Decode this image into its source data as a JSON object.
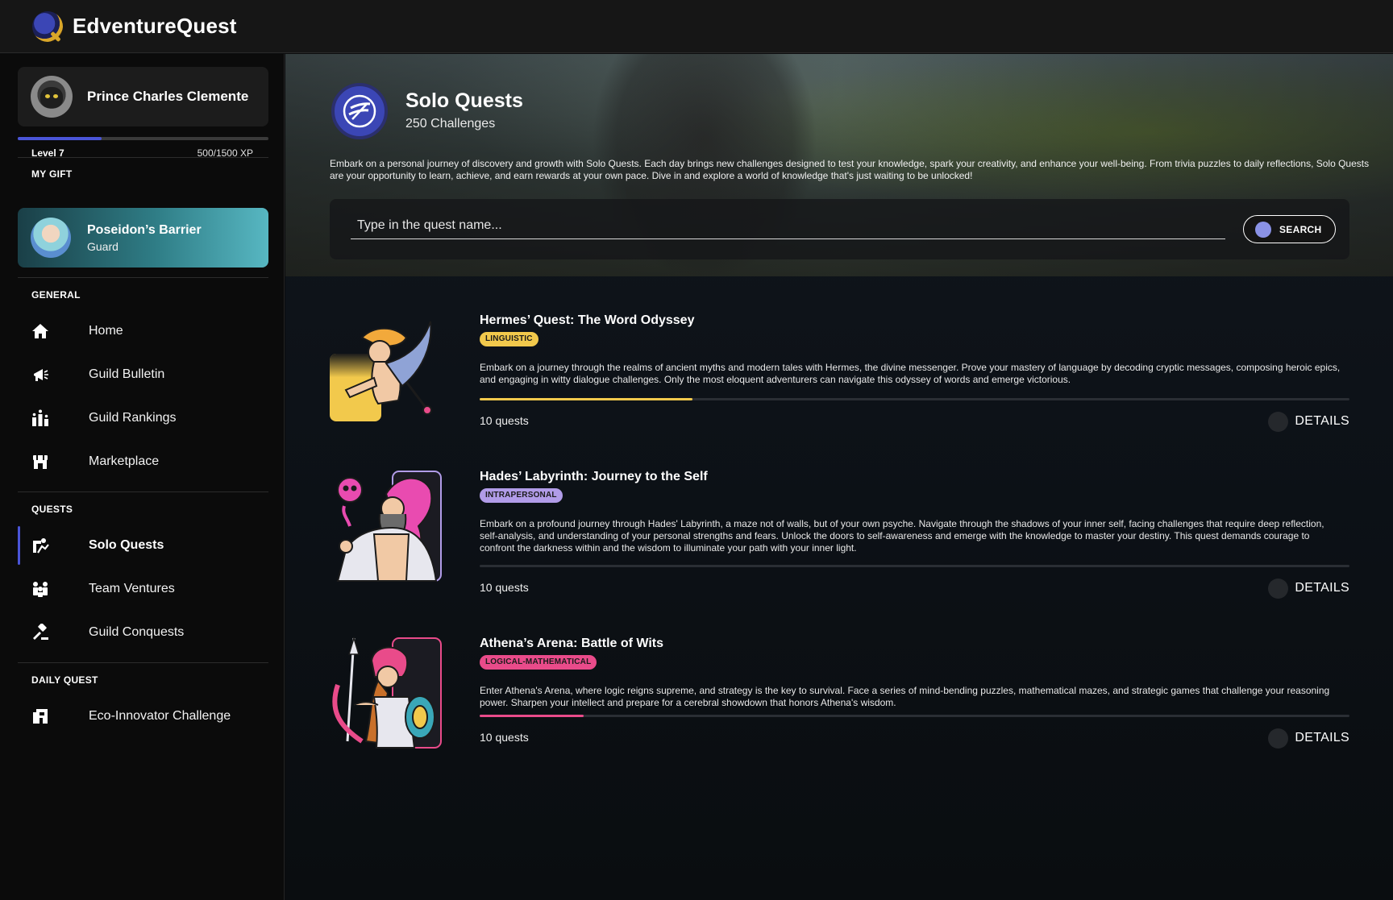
{
  "app": {
    "brand": "EdventureQuest"
  },
  "profile": {
    "name": "Prince Charles Clemente",
    "level": "Level 7",
    "xp": "500/1500 XP",
    "xp_progress": 0.333
  },
  "gift": {
    "section": "MY GIFT",
    "title": "Poseidon’s Barrier",
    "subtitle": "Guard"
  },
  "nav": {
    "general_label": "GENERAL",
    "general": [
      {
        "label": "Home",
        "icon": "home-icon"
      },
      {
        "label": "Guild Bulletin",
        "icon": "megaphone-icon"
      },
      {
        "label": "Guild Rankings",
        "icon": "rankings-icon"
      },
      {
        "label": "Marketplace",
        "icon": "store-icon"
      }
    ],
    "quests_label": "QUESTS",
    "quests": [
      {
        "label": "Solo Quests",
        "icon": "solo-quest-icon",
        "active": true
      },
      {
        "label": "Team Ventures",
        "icon": "team-icon",
        "active": false
      },
      {
        "label": "Guild Conquests",
        "icon": "gavel-icon",
        "active": false
      }
    ],
    "daily_label": "DAILY QUEST",
    "daily": [
      {
        "label": "Eco-Innovator Challenge",
        "icon": "eco-challenge-icon"
      }
    ]
  },
  "hero": {
    "title": "Solo Quests",
    "count": "250 Challenges",
    "description": "Embark on a personal journey of discovery and growth with Solo Quests. Each day brings new challenges designed to test your knowledge, spark your creativity, and enhance your well-being. From trivia puzzles to daily reflections, Solo Quests are your opportunity to learn, achieve, and earn rewards at your own pace. Dive in and explore a world of knowledge that's just waiting to be unlocked!",
    "search_placeholder": "Type in the quest name...",
    "search_label": "SEARCH"
  },
  "quests": [
    {
      "title": "Hermes’ Quest: The Word Odyssey",
      "tag": "LINGUISTIC",
      "tag_color": "#f2c94c",
      "description": "Embark on a journey through the realms of ancient myths and modern tales with Hermes, the divine messenger. Prove your mastery of language by decoding cryptic messages, composing heroic epics, and engaging in witty dialogue challenges. Only the most eloquent adventurers can navigate this odyssey of words and emerge victorious.",
      "progress": 0.245,
      "progress_color": "#f2c94c",
      "count": "10 quests",
      "details_label": "DETAILS"
    },
    {
      "title": "Hades’ Labyrinth: Journey to the Self",
      "tag": "INTRAPERSONAL",
      "tag_color": "#b19ce8",
      "description": "Embark on a profound journey through Hades' Labyrinth, a maze not of walls, but of your own psyche. Navigate through the shadows of your inner self, facing challenges that require deep reflection, self-analysis, and understanding of your personal strengths and fears. Unlock the doors to self-awareness and emerge with the knowledge to master your destiny. This quest demands courage to confront the darkness within and the wisdom to illuminate your path with your inner light.",
      "progress": 0,
      "progress_color": "#b19ce8",
      "count": "10 quests",
      "details_label": "DETAILS"
    },
    {
      "title": "Athena’s Arena: Battle of Wits",
      "tag": "LOGICAL-MATHEMATICAL",
      "tag_color": "#e94b8a",
      "description": "Enter Athena's Arena, where logic reigns supreme, and strategy is the key to survival. Face a series of mind-bending puzzles, mathematical mazes, and strategic games that challenge your reasoning power. Sharpen your intellect and prepare for a cerebral showdown that honors Athena's wisdom.",
      "progress": 0.12,
      "progress_color": "#e94b8a",
      "count": "10 quests",
      "details_label": "DETAILS"
    }
  ]
}
